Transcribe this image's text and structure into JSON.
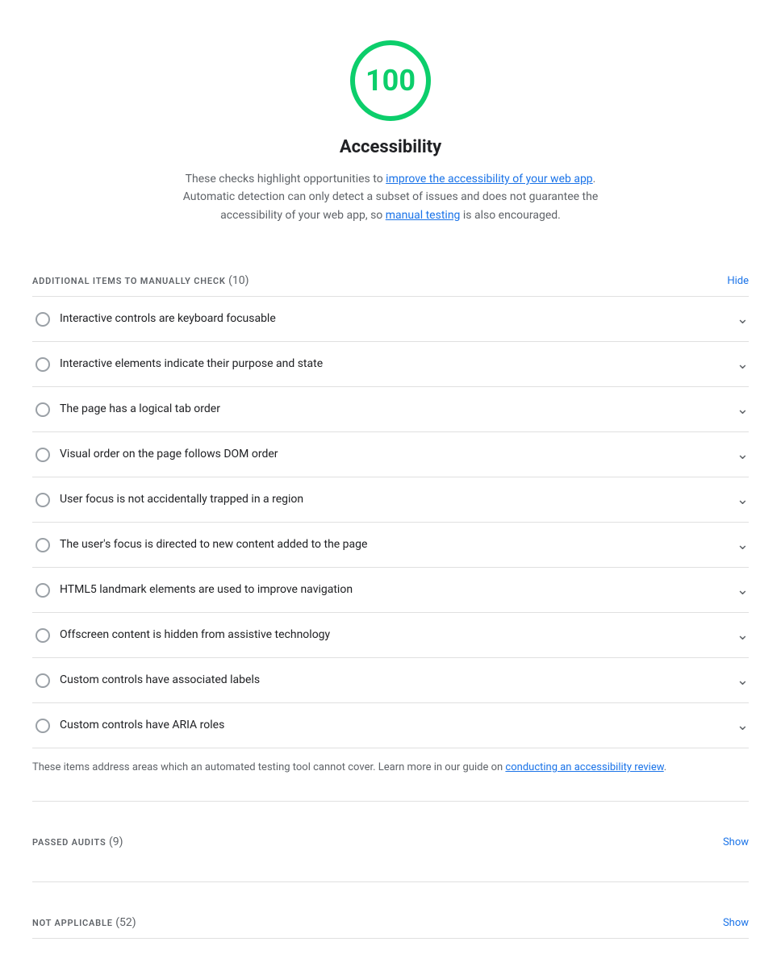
{
  "score": {
    "value": "100",
    "color": "#0cce6b",
    "title": "Accessibility"
  },
  "description": {
    "text_before": "These checks highlight opportunities to ",
    "link1_text": "improve the accessibility of your web app",
    "link1_href": "#",
    "text_middle": ". Automatic detection can only detect a subset of issues and does not guarantee the accessibility of your web app, so ",
    "link2_text": "manual testing",
    "link2_href": "#",
    "text_after": " is also encouraged."
  },
  "manual_section": {
    "title": "ADDITIONAL ITEMS TO MANUALLY CHECK",
    "count": "(10)",
    "toggle_label": "Hide"
  },
  "audit_items": [
    {
      "label": "Interactive controls are keyboard focusable"
    },
    {
      "label": "Interactive elements indicate their purpose and state"
    },
    {
      "label": "The page has a logical tab order"
    },
    {
      "label": "Visual order on the page follows DOM order"
    },
    {
      "label": "User focus is not accidentally trapped in a region"
    },
    {
      "label": "The user's focus is directed to new content added to the page"
    },
    {
      "label": "HTML5 landmark elements are used to improve navigation"
    },
    {
      "label": "Offscreen content is hidden from assistive technology"
    },
    {
      "label": "Custom controls have associated labels"
    },
    {
      "label": "Custom controls have ARIA roles"
    }
  ],
  "footer_note": {
    "text_before": "These items address areas which an automated testing tool cannot cover. Learn more in our guide on ",
    "link_text": "conducting an accessibility review",
    "link_href": "#",
    "text_after": "."
  },
  "passed_section": {
    "title": "PASSED AUDITS",
    "count": "(9)",
    "toggle_label": "Show"
  },
  "not_applicable_section": {
    "title": "NOT APPLICABLE",
    "count": "(52)",
    "toggle_label": "Show"
  }
}
